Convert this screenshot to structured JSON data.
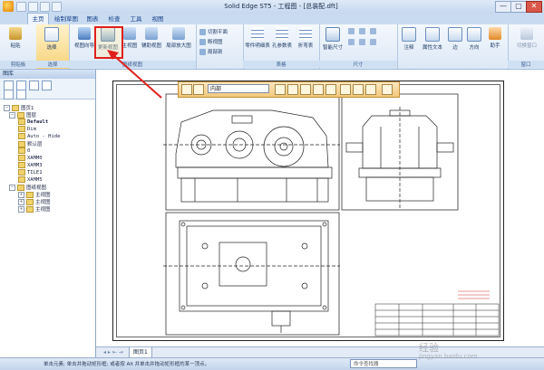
{
  "window": {
    "title": "Solid Edge ST5 - 工程图 - [总装配.dft]",
    "min_label": "—",
    "max_label": "▢",
    "close_label": "✕"
  },
  "tabs": [
    "主页",
    "绘制草图",
    "图表",
    "检查",
    "工具",
    "视图"
  ],
  "ribbon": {
    "paste": "粘贴",
    "select": "选择",
    "view_wizard": "视图向导",
    "redraw_view": "更新视图",
    "main_view": "主视图",
    "aux_view": "辅助视图",
    "section_view": "剖面视图",
    "detail_view": "局部放大图",
    "cut_plane": "切割平面",
    "broken_view": "断视图",
    "partial_section": "局部剖",
    "parts_list": "零件明细表",
    "hole_table": "孔参数表",
    "bend_table": "折弯表",
    "smart_dim": "智能尺寸",
    "annotation": "注释",
    "properties": "属性文本",
    "edge": "边",
    "direction": "方向",
    "helper": "助手",
    "switch_window": "切换窗口",
    "groups": {
      "clipboard": "剪贴板",
      "select": "选择",
      "drawing_views": "图纸视图",
      "tables": "表格",
      "dimension": "尺寸",
      "window": "窗口"
    }
  },
  "left_pane": {
    "title": "图库",
    "tree": {
      "sheet1": "图页1",
      "layers": "图层",
      "layer_items": [
        "Default",
        "Dim",
        "Auto - Hide",
        "默认层",
        "0",
        "XAMM0",
        "XAMM3",
        "TILE1",
        "XAMM5"
      ],
      "drawing_views": "图纸视图",
      "view_items": [
        "主视图",
        "主视图",
        "主视图"
      ]
    }
  },
  "command_bar": {
    "dropdown": "内部"
  },
  "sheet_tabs": [
    "图页1"
  ],
  "status": {
    "message": "单击元素; 单击并拖动矩形框; 或者按 Alt 并单击并拖动矩形框的某一顶点。",
    "command_finder_placeholder": "命令查找器"
  },
  "watermark": {
    "line1": "经验",
    "line2": "jingyan.baidu.com"
  },
  "colors": {
    "highlight": "#e0201b",
    "ribbon_bg": "#dce8f6",
    "command_bar": "#f3c879"
  }
}
